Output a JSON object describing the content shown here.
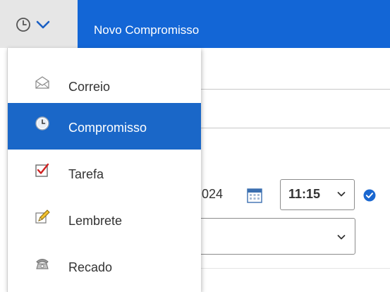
{
  "topbar": {
    "type_picker_icon": "clock-icon",
    "type_picker_chevron": "chevron-down-icon",
    "title": "Novo Compromisso",
    "bar_color": "#1366d6"
  },
  "form": {
    "date_value_partial": "024",
    "calendar_icon": "calendar-icon",
    "time_value": "11:15",
    "status_icon": "check-circle-icon"
  },
  "menu": {
    "items": [
      {
        "label": "Correio",
        "icon": "envelope-icon",
        "selected": false
      },
      {
        "label": "Compromisso",
        "icon": "clock-icon",
        "selected": true
      },
      {
        "label": "Tarefa",
        "icon": "checkbox-icon",
        "selected": false
      },
      {
        "label": "Lembrete",
        "icon": "pencil-icon",
        "selected": false
      },
      {
        "label": "Recado",
        "icon": "phone-icon",
        "selected": false
      }
    ],
    "selected_color": "#1a67c8"
  }
}
